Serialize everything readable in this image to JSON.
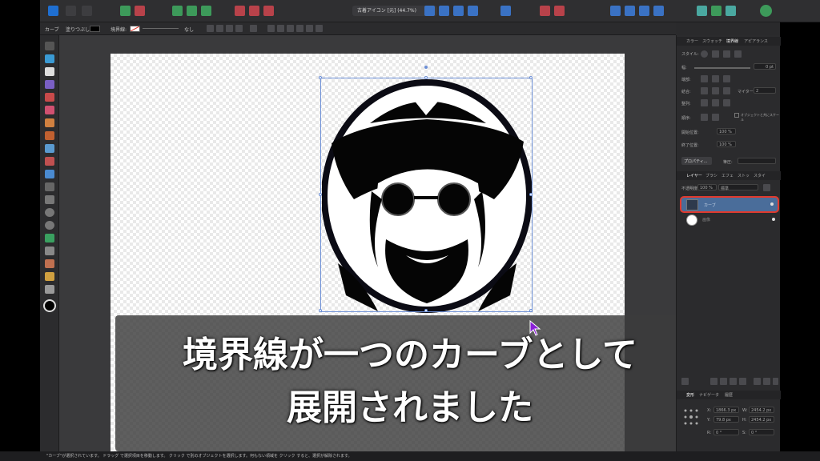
{
  "toolbar": {
    "document_title": "古着アイコン [元] (44.7%)"
  },
  "context_bar": {
    "tool_label": "カーブ",
    "fill_label": "塗りつぶし:",
    "stroke_label": "境界線:",
    "none_label": "なし"
  },
  "stroke_panel": {
    "tabs": [
      "カラー",
      "スウォッチ",
      "境界線",
      "アピアランス"
    ],
    "style_label": "スタイル:",
    "width_label": "幅:",
    "width_value": "0 pt",
    "cap_label": "端部:",
    "join_label": "結合:",
    "miter_label": "マイター:",
    "miter_value": "2",
    "align_label": "整列:",
    "order_label": "順序:",
    "scale_label": "オブジェクトと共にスケール",
    "start_label": "開始位置:",
    "end_label": "終了位置:",
    "start_value": "100 %",
    "end_value": "100 %",
    "properties_button": "プロパティ...",
    "pressure_label": "筆圧:"
  },
  "layers_panel": {
    "tabs": [
      "レイヤー",
      "ブラシ",
      "エフェ",
      "ストッ",
      "スタイ"
    ],
    "opacity_label": "不透明度:",
    "opacity_value": "100 %",
    "blend_mode": "標準",
    "layers": [
      {
        "name": "カーブ",
        "selected": true
      },
      {
        "name": "画像",
        "selected": false
      }
    ]
  },
  "transform_panel": {
    "tabs": [
      "変形",
      "ナビゲータ",
      "履歴"
    ],
    "x_label": "X:",
    "x_value": "1866.3 px",
    "y_label": "Y:",
    "y_value": "79.8 px",
    "w_label": "W:",
    "w_value": "2454.2 px",
    "h_label": "H:",
    "h_value": "2454.2 px",
    "r_label": "R:",
    "r_value": "0 °",
    "s_label": "S:",
    "s_value": "0 °"
  },
  "caption": {
    "line1": "境界線が一つのカーブとして",
    "line2": "展開されました"
  },
  "status_bar": {
    "text": "\"カーブ\"が選択されています。 ドラッグ で選択項目を移動します。 クリック で別のオブジェクトを選択します。何もない領域を クリック すると、選択が解除されます。"
  },
  "colors": {
    "selection_accent": "#6c8fd6",
    "highlight_red": "#e03a2e",
    "layer_selected": "#4a6d9a"
  }
}
